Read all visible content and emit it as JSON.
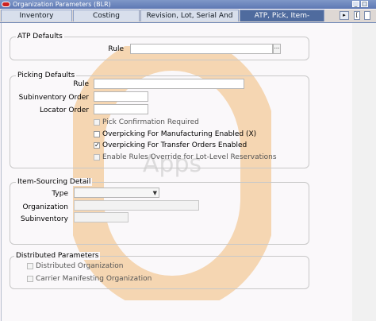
{
  "window": {
    "title": "Organization Parameters (BLR)"
  },
  "tabs": [
    {
      "label": "Inventory Parameters"
    },
    {
      "label": "Costing Information"
    },
    {
      "label": "Revision, Lot, Serial And LPN"
    },
    {
      "label": "ATP, Pick, Item-Sourcing"
    }
  ],
  "atp_defaults": {
    "title": "ATP Defaults",
    "rule_label": "Rule",
    "rule_value": ""
  },
  "picking_defaults": {
    "title": "Picking Defaults",
    "rule_label": "Rule",
    "rule_value": "",
    "subinventory_order_label": "Subinventory Order",
    "subinventory_order_value": "",
    "locator_order_label": "Locator Order",
    "locator_order_value": "",
    "checkboxes": [
      {
        "label": "Pick Confirmation Required",
        "checked": false,
        "enabled": false
      },
      {
        "label": "Overpicking For Manufacturing Enabled (X)",
        "checked": false,
        "enabled": true
      },
      {
        "label": "Overpicking For Transfer Orders Enabled",
        "checked": true,
        "enabled": true
      },
      {
        "label": "Enable Rules Override for Lot-Level Reservations",
        "checked": false,
        "enabled": false
      }
    ]
  },
  "item_sourcing": {
    "title": "Item-Sourcing Detail",
    "type_label": "Type",
    "type_value": "",
    "organization_label": "Organization",
    "organization_value": "",
    "subinventory_label": "Subinventory",
    "subinventory_value": ""
  },
  "distributed_parameters": {
    "title": "Distributed Parameters",
    "checkboxes": [
      {
        "label": "Distributed Organization",
        "checked": false,
        "enabled": false
      },
      {
        "label": "Carrier Manifesting Organization",
        "checked": false,
        "enabled": false
      }
    ]
  },
  "watermark": {
    "text": "Apps",
    "color": "#e8a04a"
  }
}
